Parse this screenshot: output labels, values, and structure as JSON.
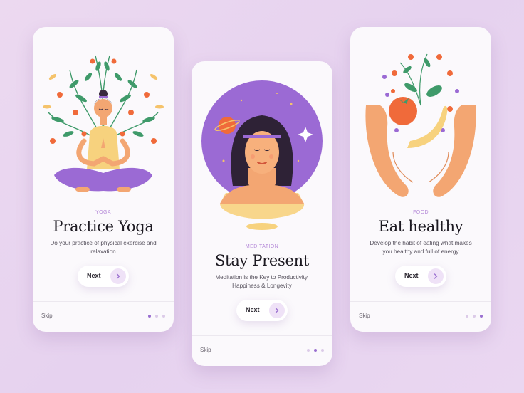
{
  "cards": [
    {
      "category": "YOGA",
      "title": "Practice Yoga",
      "description": "Do your practice of physical exercise and relaxation",
      "next_label": "Next",
      "skip_label": "Skip",
      "active_dot": 1
    },
    {
      "category": "MEDITATION",
      "title": "Stay Present",
      "description": "Meditation is the Key to Productivity, Happiness & Longevity",
      "next_label": "Next",
      "skip_label": "Skip",
      "active_dot": 2
    },
    {
      "category": "FOOD",
      "title": "Eat healthy",
      "description": "Develop the habit of eating what makes you healthy and full of energy",
      "next_label": "Next",
      "skip_label": "Skip",
      "active_dot": 3
    }
  ],
  "colors": {
    "accent": "#b58ad8",
    "accent_dark": "#9a6fd0",
    "background": "#eadaf2",
    "card": "#fbf9fc",
    "purple_fill": "#9b6ad4",
    "orange": "#f06a3a",
    "green": "#3f9a6a"
  },
  "icons": [
    "chevron-right-icon",
    "yoga-woman-illustration",
    "meditation-woman-illustration",
    "healthy-food-hands-illustration"
  ]
}
